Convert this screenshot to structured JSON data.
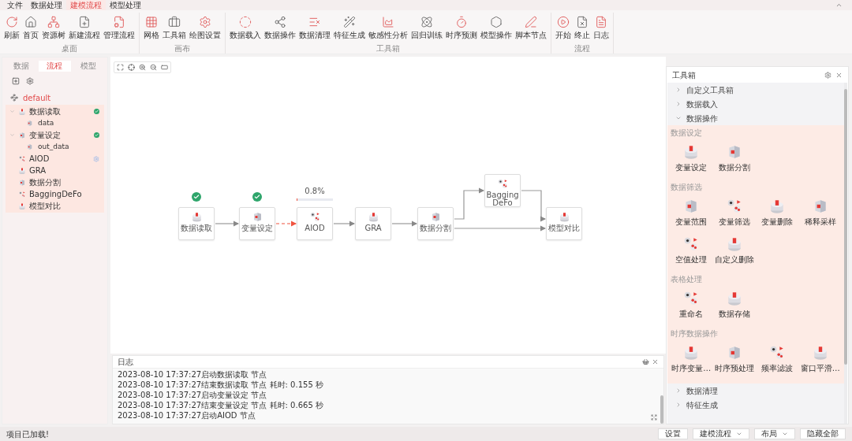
{
  "menu": [
    {
      "label": "文件",
      "selected": false
    },
    {
      "label": "数据处理",
      "selected": false
    },
    {
      "label": "建模流程",
      "selected": true
    },
    {
      "label": "模型处理",
      "selected": false
    }
  ],
  "ribbon": [
    {
      "title": "桌面",
      "items": [
        "刷新",
        "首页",
        "资源树",
        "新建流程",
        "管理流程"
      ]
    },
    {
      "title": "画布",
      "items": [
        "网格",
        "工具箱",
        "绘图设置"
      ]
    },
    {
      "title": "工具箱",
      "items": [
        "数据载入",
        "数据操作",
        "数据清理",
        "特征生成",
        "敏感性分析",
        "回归训练",
        "时序预测",
        "模型操作",
        "脚本节点"
      ]
    },
    {
      "title": "流程",
      "items": [
        "开始",
        "终止",
        "日志"
      ]
    }
  ],
  "left_panel": {
    "tabs": [
      {
        "label": "数据",
        "selected": false
      },
      {
        "label": "流程",
        "selected": true
      },
      {
        "label": "模型",
        "selected": false
      }
    ],
    "root": "default",
    "tree": [
      {
        "label": "数据读取",
        "expanded": true,
        "done": true,
        "running": false,
        "children": [
          {
            "label": "data"
          }
        ]
      },
      {
        "label": "变量设定",
        "expanded": true,
        "done": true,
        "running": false,
        "children": [
          {
            "label": "out_data"
          }
        ]
      },
      {
        "label": "AIOD",
        "done": false,
        "running": true
      },
      {
        "label": "GRA",
        "done": false,
        "running": false
      },
      {
        "label": "数据分割",
        "done": false,
        "running": false
      },
      {
        "label": "BaggingDeFo",
        "done": false,
        "running": false
      },
      {
        "label": "模型对比",
        "done": false,
        "running": false
      }
    ]
  },
  "canvas": {
    "nodes": [
      {
        "label": "数据读取",
        "done": true,
        "running": false
      },
      {
        "label": "变量设定",
        "done": true,
        "running": false
      },
      {
        "label": "AIOD",
        "done": false,
        "running": true,
        "progress": "0.8%",
        "level": 0.008
      },
      {
        "label": "GRA",
        "done": false,
        "running": false
      },
      {
        "label": "数据分割",
        "done": false,
        "running": false
      },
      {
        "label": "BaggingDeFo",
        "done": false,
        "running": false
      },
      {
        "label": "模型对比",
        "done": false,
        "running": false
      }
    ]
  },
  "toolbox": {
    "title": "工具箱",
    "sections": [
      {
        "title": "自定义工具箱",
        "expanded": false
      },
      {
        "title": "数据载入",
        "expanded": false
      },
      {
        "title": "数据操作",
        "expanded": true,
        "groups": [
          {
            "title": "数据设定",
            "items": [
              "变量设定",
              "数据分割"
            ]
          },
          {
            "title": "数据筛选",
            "items": [
              "变量范围",
              "变量筛选",
              "变量删除",
              "稀释采样",
              "空值处理",
              "自定义删除"
            ]
          },
          {
            "title": "表格处理",
            "items": [
              "重命名",
              "数据存储"
            ]
          },
          {
            "title": "时序数据操作",
            "items": [
              "时序变量…",
              "时序预处理",
              "频率滤波",
              "窗口平滑…"
            ]
          }
        ]
      },
      {
        "title": "数据清理",
        "expanded": false
      },
      {
        "title": "特征生成",
        "expanded": false
      }
    ]
  },
  "log": {
    "title": "日志",
    "lines": [
      "2023-08-10 17:37:27启动数据读取 节点",
      "2023-08-10 17:37:27结束数据读取 节点 耗时: 0.155 秒",
      "2023-08-10 17:37:27启动变量设定 节点",
      "2023-08-10 17:37:27结束变量设定 节点 耗时: 0.665 秒",
      "2023-08-10 17:37:27启动AIOD 节点"
    ]
  },
  "status_bar": {
    "message": "项目已加载!",
    "buttons": [
      {
        "label": "设置",
        "dropdown": false
      },
      {
        "label": "建模流程",
        "dropdown": true
      },
      {
        "label": "布局",
        "dropdown": true
      },
      {
        "label": "隐藏全部",
        "dropdown": false
      }
    ]
  }
}
